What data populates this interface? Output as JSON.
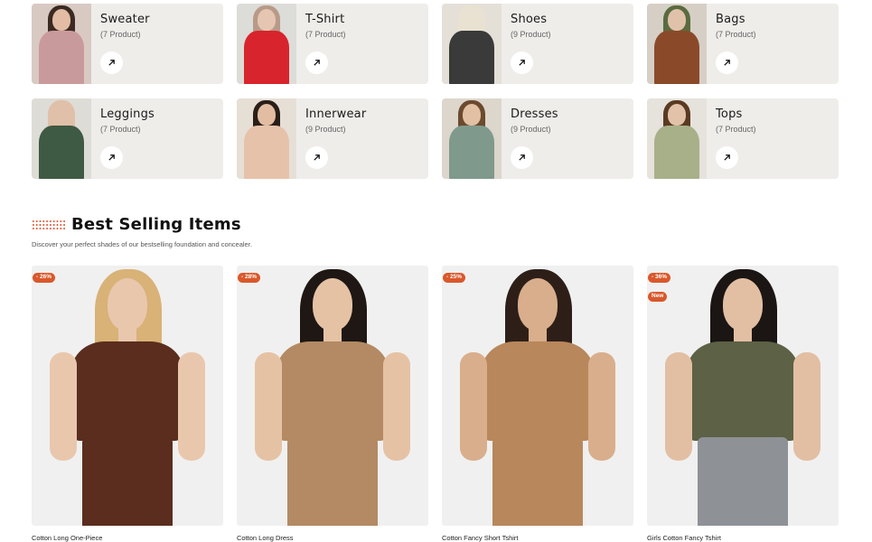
{
  "categories": [
    {
      "name": "Sweater",
      "count": "(7 Product)",
      "bg": "#d9c9c3",
      "garment": "#c99a9c",
      "hair": "#3b2a22",
      "skin": "#e2bca4"
    },
    {
      "name": "T-Shirt",
      "count": "(7 Product)",
      "bg": "#dcdcd8",
      "garment": "#d8242c",
      "hair": "#b89a88",
      "skin": "#e6c6b2"
    },
    {
      "name": "Shoes",
      "count": "(9 Product)",
      "bg": "#e4e0d8",
      "garment": "#3a3a3a",
      "hair": "#e9e2d2",
      "skin": "#e9e2d2"
    },
    {
      "name": "Bags",
      "count": "(7 Product)",
      "bg": "#d6cfc6",
      "garment": "#8a4a2a",
      "hair": "#5a6b3f",
      "skin": "#e0c2ab"
    },
    {
      "name": "Leggings",
      "count": "(7 Product)",
      "bg": "#dedcd6",
      "garment": "#3e5a44",
      "hair": "#e0c0a8",
      "skin": "#e0c0a8"
    },
    {
      "name": "Innerwear",
      "count": "(9 Product)",
      "bg": "#e6dfd6",
      "garment": "#e6c2aa",
      "hair": "#2a1e18",
      "skin": "#e2bda2"
    },
    {
      "name": "Dresses",
      "count": "(9 Product)",
      "bg": "#dcd6cc",
      "garment": "#7f9a8c",
      "hair": "#6b4a2e",
      "skin": "#e1c0a4"
    },
    {
      "name": "Tops",
      "count": "(7 Product)",
      "bg": "#e6e2dc",
      "garment": "#a8b08a",
      "hair": "#5a3a22",
      "skin": "#e2c2a8"
    }
  ],
  "section": {
    "title": "Best Selling Items",
    "subtitle": "Discover your perfect shades of our bestselling foundation and concealer."
  },
  "products": [
    {
      "name": "Cotton Long One-Piece",
      "badges": [
        "- 26%"
      ],
      "garment": "#5a2d1e",
      "hair": "#d8b277",
      "skin": "#e9c7ad",
      "pants": "#5a2d1e"
    },
    {
      "name": "Cotton Long Dress",
      "badges": [
        "- 28%"
      ],
      "garment": "#b38a63",
      "hair": "#1e1714",
      "skin": "#e6c2a4",
      "pants": "#b38a63"
    },
    {
      "name": "Cotton Fancy Short Tshirt",
      "badges": [
        "- 25%"
      ],
      "garment": "#b8875b",
      "hair": "#2d1f18",
      "skin": "#d9ae8c",
      "pants": "#b8875b"
    },
    {
      "name": "Girls Cotton Fancy Tshirt",
      "badges": [
        "- 36%",
        "New"
      ],
      "garment": "#5d6145",
      "hair": "#1b1614",
      "skin": "#e2bfa3",
      "pants": "#8e9296"
    }
  ]
}
